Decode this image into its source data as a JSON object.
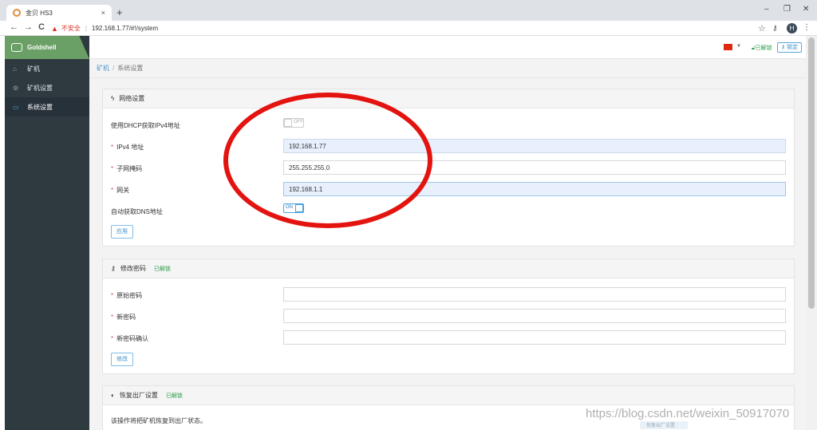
{
  "browser": {
    "tab_title": "金贝 HS3",
    "tab_close": "×",
    "new_tab": "+",
    "win_min": "–",
    "win_max": "❐",
    "win_close": "✕",
    "back": "←",
    "forward": "→",
    "reload": "C",
    "insecure_label": "不安全",
    "url": "192.168.1.77/#!/system",
    "avatar_letter": "H"
  },
  "app": {
    "brand": "Goldshell",
    "brand_color": "#6aa065",
    "accent": "#4aa3df",
    "sidebar": {
      "items": [
        {
          "label": "矿机",
          "icon": "home-icon"
        },
        {
          "label": "矿机设置",
          "icon": "gear-icon"
        },
        {
          "label": "系统设置",
          "icon": "monitor-icon"
        }
      ]
    },
    "topbar": {
      "unlocked": "已解锁",
      "lock_button": "锁定"
    },
    "breadcrumb": {
      "root": "矿机",
      "separator": "/",
      "current": "系统设置"
    },
    "network": {
      "title": "网络设置",
      "dhcp_label": "使用DHCP获取IPv4地址",
      "dhcp_state": "OFF",
      "ipv4_label": "IPv4 地址",
      "ipv4_value": "192.168.1.77",
      "subnet_label": "子网掩码",
      "subnet_value": "255.255.255.0",
      "gateway_label": "网关",
      "gateway_value": "192.168.1.1",
      "dns_label": "自动获取DNS地址",
      "dns_state": "ON",
      "apply_button": "应用",
      "required_mark": "*"
    },
    "password": {
      "title": "修改密码",
      "badge": "已解锁",
      "old_label": "原始密码",
      "new_label": "新密码",
      "confirm_label": "新密码确认",
      "submit_button": "修改",
      "required_mark": "*"
    },
    "factory": {
      "title": "恢复出厂设置",
      "badge": "已解锁",
      "description": "该操作将把矿机恢复到出厂状态。",
      "ghost_button": "恢复出厂设置"
    }
  },
  "watermark": "https://blog.csdn.net/weixin_50917070"
}
